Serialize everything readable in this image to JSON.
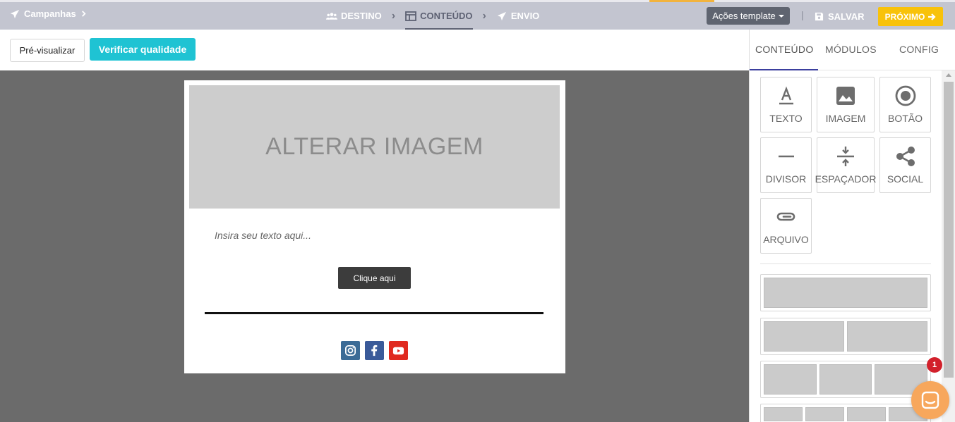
{
  "topbar": {
    "breadcrumb": "Campanhas",
    "steps": [
      {
        "label": "DESTINO"
      },
      {
        "label": "CONTEÚDO"
      },
      {
        "label": "ENVIO"
      }
    ],
    "actions_label": "Ações template",
    "separator": "|",
    "save_label": "SALVAR",
    "next_label": "PRÓXIMO"
  },
  "actionbar": {
    "preview_label": "Pré-visualizar",
    "verify_label": "Verificar qualidade"
  },
  "email": {
    "image_placeholder": "ALTERAR IMAGEM",
    "text_placeholder": "Insira seu texto aqui...",
    "button_label": "Clique aqui",
    "social": [
      "instagram-icon",
      "facebook-icon",
      "youtube-icon"
    ]
  },
  "panel": {
    "tabs": [
      {
        "label": "CONTEÚDO"
      },
      {
        "label": "MÓDULOS"
      },
      {
        "label": "CONFIG"
      }
    ],
    "blocks": [
      {
        "label": "TEXTO",
        "icon": "text-icon"
      },
      {
        "label": "IMAGEM",
        "icon": "image-icon"
      },
      {
        "label": "BOTÃO",
        "icon": "button-icon"
      },
      {
        "label": "DIVISOR",
        "icon": "divider-icon"
      },
      {
        "label": "ESPAÇADOR",
        "icon": "spacer-icon"
      },
      {
        "label": "SOCIAL",
        "icon": "share-icon"
      },
      {
        "label": "ARQUIVO",
        "icon": "paperclip-icon"
      }
    ],
    "layouts": [
      1,
      2,
      3,
      4
    ]
  },
  "chat": {
    "badge": "1"
  },
  "colors": {
    "topbar": "#c3c5d0",
    "accent_teal": "#1fc3d3",
    "accent_yellow": "#f8c20a",
    "tab_active": "#3b3f9e",
    "chat": "#f7a75c",
    "badge": "#d2202b"
  }
}
